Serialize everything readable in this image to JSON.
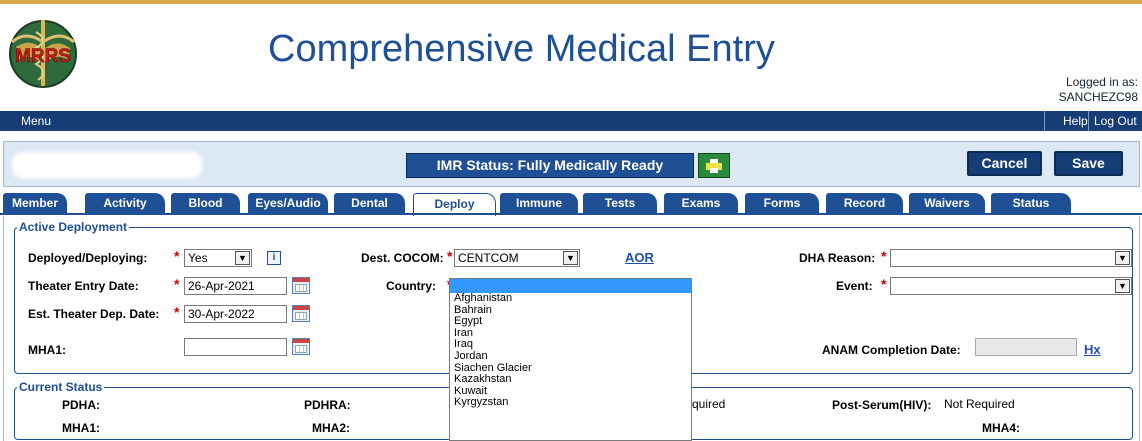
{
  "header": {
    "title": "Comprehensive Medical Entry",
    "logo_text": "MRRS",
    "logged_in_label": "Logged in as:",
    "username": "SANCHEZC98"
  },
  "menubar": {
    "menu": "Menu",
    "help": "Help",
    "logout": "Log Out"
  },
  "status_strip": {
    "imr_status": "IMR Status: Fully Medically Ready",
    "cancel": "Cancel",
    "save": "Save"
  },
  "tabs": [
    {
      "label": "Member"
    },
    {
      "label": "Activity"
    },
    {
      "label": "Blood"
    },
    {
      "label": "Eyes/Audio"
    },
    {
      "label": "Dental"
    },
    {
      "label": "Deploy",
      "active": true
    },
    {
      "label": "Immune"
    },
    {
      "label": "Tests"
    },
    {
      "label": "Exams"
    },
    {
      "label": "Forms"
    },
    {
      "label": "Record"
    },
    {
      "label": "Waivers"
    },
    {
      "label": "Status"
    }
  ],
  "active_deployment": {
    "legend": "Active Deployment",
    "deployed_label": "Deployed/Deploying:",
    "deployed_value": "Yes",
    "theater_entry_label": "Theater Entry Date:",
    "theater_entry_value": "26-Apr-2021",
    "est_dep_label": "Est. Theater Dep. Date:",
    "est_dep_value": "30-Apr-2022",
    "mha1_label": "MHA1:",
    "mha1_value": "",
    "dest_cocom_label": "Dest. COCOM:",
    "dest_cocom_value": "CENTCOM",
    "aor_link": "AOR",
    "country_label": "Country:",
    "dha_reason_label": "DHA Reason:",
    "event_label": "Event:",
    "anam_label": "ANAM Completion Date:",
    "hx_link": "Hx"
  },
  "country_options": [
    "",
    "Afghanistan",
    "Bahrain",
    "Egypt",
    "Iran",
    "Iraq",
    "Jordan",
    "Siachen Glacier",
    "Kazakhstan",
    "Kuwait",
    "Kyrgyzstan"
  ],
  "current_status": {
    "legend": "Current Status",
    "pdha_label": "PDHA:",
    "pdhra_label": "PDHRA:",
    "mha1_label": "MHA1:",
    "mha2_label": "MHA2:",
    "partial_text": "quired",
    "post_serum_label": "Post-Serum(HIV):",
    "post_serum_value": "Not Required",
    "mha4_label": "MHA4:"
  },
  "colors": {
    "brand_blue": "#1f4f95",
    "menubar": "#173d76",
    "required": "#d40000",
    "print_green": "#2b8a3c"
  }
}
